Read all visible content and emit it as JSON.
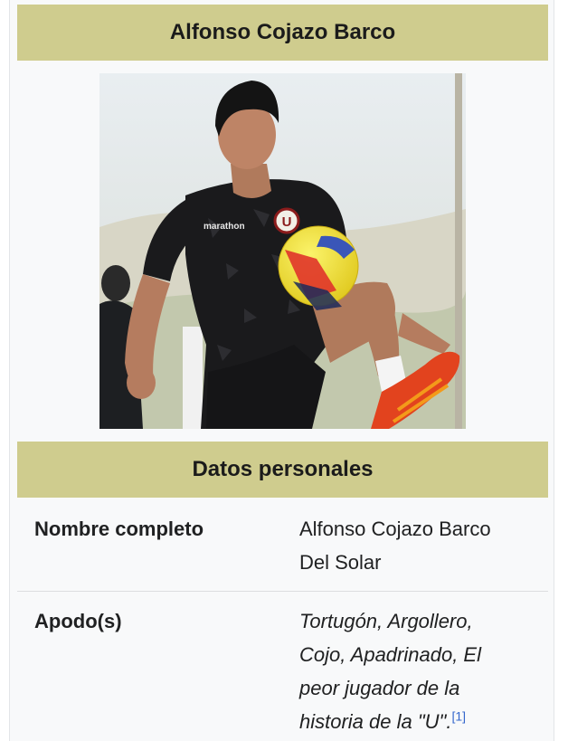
{
  "infobox": {
    "title": "Alfonso Cojazo Barco",
    "image": {
      "jersey_brand": "marathon",
      "club_badge": "U"
    },
    "section_title": "Datos personales",
    "rows": [
      {
        "label": "Nombre completo",
        "value_lines": [
          "Alfonso Cojazo Barco",
          "Del Solar"
        ]
      },
      {
        "label": "Apodo(s)",
        "value_lines": [
          "Tortugón, Argollero,",
          "Cojo, Apadrinado, El",
          "peor jugador de la",
          "historia de la \"U\"."
        ],
        "reference": "[1]"
      }
    ]
  },
  "colors": {
    "header_band": "#cfcc8e",
    "infobox_bg": "#f8f9fa",
    "reference_link": "#3366cc"
  }
}
